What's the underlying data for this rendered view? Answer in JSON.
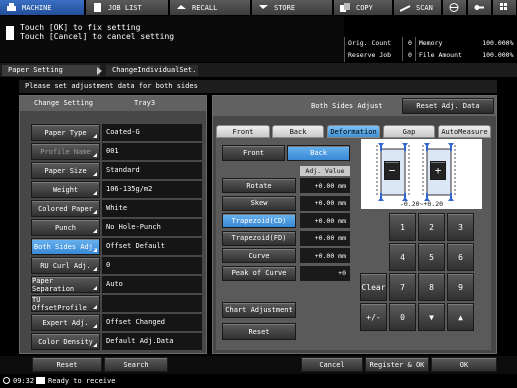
{
  "top_tabs": [
    {
      "label": "MACHINE",
      "icon": "printer-icon",
      "active": true
    },
    {
      "label": "JOB LIST",
      "icon": "document-icon"
    },
    {
      "label": "RECALL",
      "icon": "recall-icon"
    },
    {
      "label": "STORE",
      "icon": "store-icon"
    },
    {
      "label": "COPY",
      "icon": "copy-icon"
    },
    {
      "label": "SCAN",
      "icon": "scan-icon"
    }
  ],
  "message": {
    "line1": "Touch [OK] to fix setting",
    "line2": "Touch [Cancel] to cancel setting"
  },
  "status": {
    "orig_count_label": "Orig. Count",
    "orig_count": "0",
    "memory_label": "Memory",
    "memory": "100.000%",
    "reserve_job_label": "Reserve Job",
    "reserve_job": "0",
    "file_amount_label": "File Amount",
    "file_amount": "100.000%"
  },
  "breadcrumb": {
    "item1": "Paper Setting",
    "item2": "ChangeIndividualSet."
  },
  "info": "Please set adjustment data for both sides",
  "left": {
    "header_label": "Change Setting",
    "header_tray": "Tray3",
    "rows": [
      {
        "label": "Paper Type",
        "value": "Coated-G"
      },
      {
        "label": "Profile Name",
        "value": "001",
        "disabled": true
      },
      {
        "label": "Paper Size",
        "value": "Standard"
      },
      {
        "label": "Weight",
        "value": "106-135g/m2"
      },
      {
        "label": "Colored Paper",
        "value": "White"
      },
      {
        "label": "Punch",
        "value": "No Hole-Punch"
      },
      {
        "label": "Both Sides Adj.",
        "value": "Offset Default",
        "selected": true
      },
      {
        "label": "RU Curl Adj.",
        "value": "0"
      },
      {
        "label": "Paper Separation",
        "value": "Auto"
      },
      {
        "label": "TU OffsetProfile",
        "value": ""
      },
      {
        "label": "Expert Adj.",
        "value": "Offset Changed"
      },
      {
        "label": "Color Density",
        "value": "Default Adj.Data"
      }
    ]
  },
  "right": {
    "title": "Both Sides Adjust",
    "reset_adj": "Reset Adj. Data",
    "tabs": [
      "Front",
      "Back",
      "Deformation",
      "Gap",
      "AutoMeasure"
    ],
    "selected_tab": 2,
    "front_label": "Front",
    "back_label": "Back",
    "adj_value_label": "Adj. Value",
    "items": [
      {
        "label": "Rotate",
        "value": "+0.00 mm"
      },
      {
        "label": "Skew",
        "value": "+0.00 mm"
      },
      {
        "label": "Trapezoid(CD)",
        "value": "+0.00 mm",
        "selected": true
      },
      {
        "label": "Trapezoid(FD)",
        "value": "+0.00 mm"
      },
      {
        "label": "Curve",
        "value": "+0.00 mm"
      },
      {
        "label": "Peak of Curve",
        "value": "+0"
      }
    ],
    "range": "-0.20~+0.20",
    "minus": "−",
    "plus": "+",
    "chart_adjustment": "Chart Adjustment",
    "reset": "Reset",
    "keypad": [
      "1",
      "2",
      "3",
      "4",
      "5",
      "6",
      "Clear",
      "7",
      "8",
      "9",
      "+/-",
      "0",
      "▼",
      "▲"
    ]
  },
  "bottom": {
    "reset": "Reset",
    "search": "Search",
    "cancel": "Cancel",
    "register_ok": "Register & OK",
    "ok": "OK"
  },
  "footer": {
    "time": "09:32",
    "status": "Ready to receive"
  }
}
